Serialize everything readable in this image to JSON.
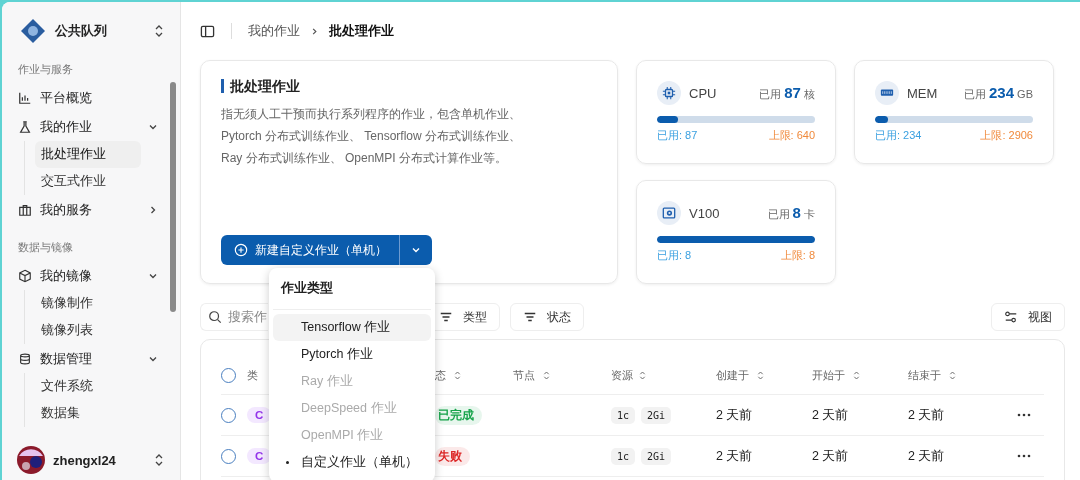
{
  "workspace": {
    "name": "公共队列"
  },
  "sidebar": {
    "sections": [
      {
        "title": "作业与服务",
        "items": [
          {
            "label": "平台概览"
          },
          {
            "label": "我的作业",
            "expanded": true,
            "children": [
              {
                "label": "批处理作业",
                "selected": true
              },
              {
                "label": "交互式作业",
                "selected": false
              }
            ]
          },
          {
            "label": "我的服务",
            "expanded": false
          }
        ]
      },
      {
        "title": "数据与镜像",
        "items": [
          {
            "label": "我的镜像",
            "expanded": true,
            "children": [
              {
                "label": "镜像制作",
                "selected": false
              },
              {
                "label": "镜像列表",
                "selected": false
              }
            ]
          },
          {
            "label": "数据管理",
            "expanded": true,
            "children": [
              {
                "label": "文件系统",
                "selected": false
              },
              {
                "label": "数据集",
                "selected": false
              }
            ]
          }
        ]
      }
    ],
    "user": {
      "name": "zhengxl24"
    }
  },
  "breadcrumb": [
    "我的作业",
    "批处理作业"
  ],
  "intro": {
    "title": "批处理作业",
    "description": "指无须人工干预而执行系列程序的作业，包含单机作业、 Pytorch 分布式训练作业、 Tensorflow 分布式训练作业、 Ray 分布式训练作业、 OpenMPI 分布式计算作业等。",
    "button": "新建自定义作业（单机）"
  },
  "resources": [
    {
      "kind": "cpu",
      "name": "CPU",
      "used_prefix": "已用",
      "used": "87",
      "unit": "核",
      "level": 0.136,
      "used_label": "已用: 87",
      "limit_label": "上限: 640"
    },
    {
      "kind": "memory",
      "name": "MEM",
      "used_prefix": "已用",
      "used": "234",
      "unit": "GB",
      "level": 0.08,
      "used_label": "已用: 234",
      "limit_label": "上限: 2906"
    },
    {
      "kind": "gpu",
      "name": "V100",
      "used_prefix": "已用",
      "used": "8",
      "unit": "卡",
      "level": 1,
      "used_label": "已用: 8",
      "limit_label": "上限: 8"
    }
  ],
  "menu": {
    "title": "作业类型",
    "items": [
      {
        "label": "Tensorflow 作业",
        "disabled": false,
        "highlighted": true,
        "current": false
      },
      {
        "label": "Pytorch 作业",
        "disabled": false,
        "highlighted": false,
        "current": false
      },
      {
        "label": "Ray 作业",
        "disabled": true,
        "highlighted": false,
        "current": false
      },
      {
        "label": "DeepSpeed 作业",
        "disabled": true,
        "highlighted": false,
        "current": false
      },
      {
        "label": "OpenMPI 作业",
        "disabled": true,
        "highlighted": false,
        "current": false
      },
      {
        "label": "自定义作业（单机）",
        "disabled": false,
        "highlighted": false,
        "current": true
      }
    ]
  },
  "toolbar": {
    "search_placeholder": "搜索作",
    "filters": [
      "类型",
      "状态"
    ],
    "view_button": "视图"
  },
  "table": {
    "all_checked": false,
    "columns": [
      "类",
      "态",
      "节点",
      "资源",
      "创建于",
      "开始于",
      "结束于"
    ],
    "rows": [
      {
        "checked": false,
        "type": "C",
        "status": {
          "label": "已完成",
          "color": "#16a34a"
        },
        "resources": [
          "1c",
          "2Gi"
        ],
        "created": "2 天前",
        "started": "2 天前",
        "ended": "2 天前"
      },
      {
        "checked": false,
        "type": "C",
        "status": {
          "label": "失败",
          "color": "#dc2626"
        },
        "resources": [
          "1c",
          "2Gi"
        ],
        "created": "2 天前",
        "started": "2 天前",
        "ended": "2 天前"
      }
    ]
  }
}
